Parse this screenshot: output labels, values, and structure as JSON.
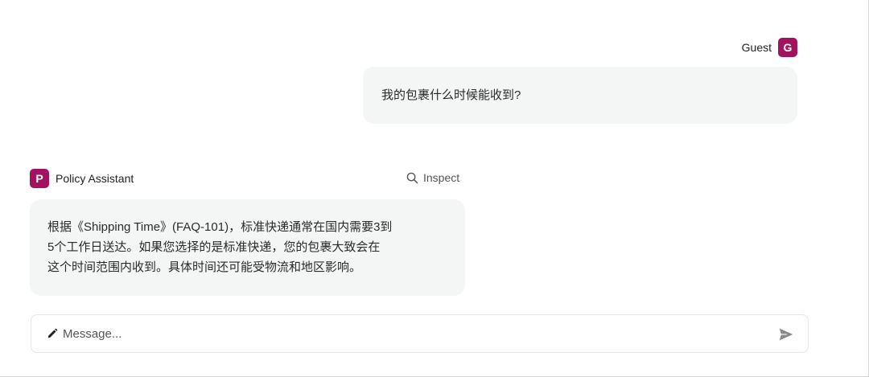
{
  "guest": {
    "name": "Guest",
    "avatar_letter": "G",
    "avatar_color": "#a3125f"
  },
  "messages": {
    "user": {
      "text": "我的包裹什么时候能收到?"
    },
    "assistant": {
      "name": "Policy Assistant",
      "avatar_letter": "P",
      "avatar_color": "#a3125f",
      "inspect_label": "Inspect",
      "lines": [
        "根据《Shipping Time》(FAQ-101)，标准快递通常在国内需要3到",
        "5个工作日送达。如果您选择的是标准快递，您的包裹大致会在",
        "这个时间范围内收到。具体时间还可能受物流和地区影响。"
      ]
    }
  },
  "composer": {
    "placeholder": "Message...",
    "value": ""
  },
  "icons": {
    "inspect": "search-icon",
    "composer": "pencil-icon",
    "send": "send-icon"
  }
}
